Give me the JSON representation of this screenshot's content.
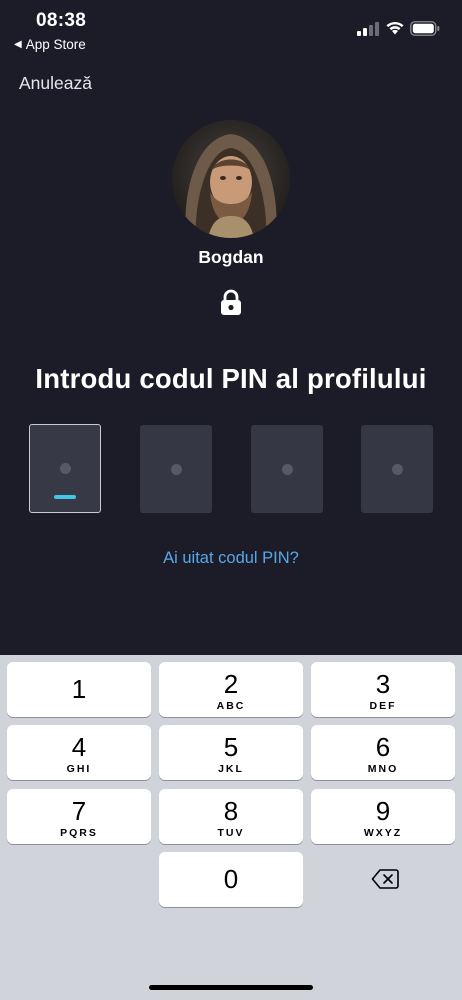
{
  "status_bar": {
    "time": "08:38",
    "back_app": "App Store",
    "back_icon": "back-triangle-icon"
  },
  "header": {
    "cancel_label": "Anulează"
  },
  "profile": {
    "name": "Bogdan",
    "lock_icon": "lock-icon"
  },
  "pin": {
    "title": "Introdu codul PIN al profilului",
    "length": 4,
    "filled": 0,
    "active_index": 0,
    "forgot_label": "Ai uitat codul PIN?"
  },
  "keypad": {
    "keys": [
      {
        "digit": "1",
        "letters": ""
      },
      {
        "digit": "2",
        "letters": "ABC"
      },
      {
        "digit": "3",
        "letters": "DEF"
      },
      {
        "digit": "4",
        "letters": "GHI"
      },
      {
        "digit": "5",
        "letters": "JKL"
      },
      {
        "digit": "6",
        "letters": "MNO"
      },
      {
        "digit": "7",
        "letters": "PQRS"
      },
      {
        "digit": "8",
        "letters": "TUV"
      },
      {
        "digit": "9",
        "letters": "WXYZ"
      },
      {
        "digit": "0",
        "letters": ""
      }
    ],
    "backspace_icon": "backspace-icon"
  },
  "colors": {
    "background": "#1b1c28",
    "pin_box": "#353744",
    "cursor": "#40c6e6",
    "link": "#5aa7e8",
    "keypad_bg": "#d0d3da"
  }
}
